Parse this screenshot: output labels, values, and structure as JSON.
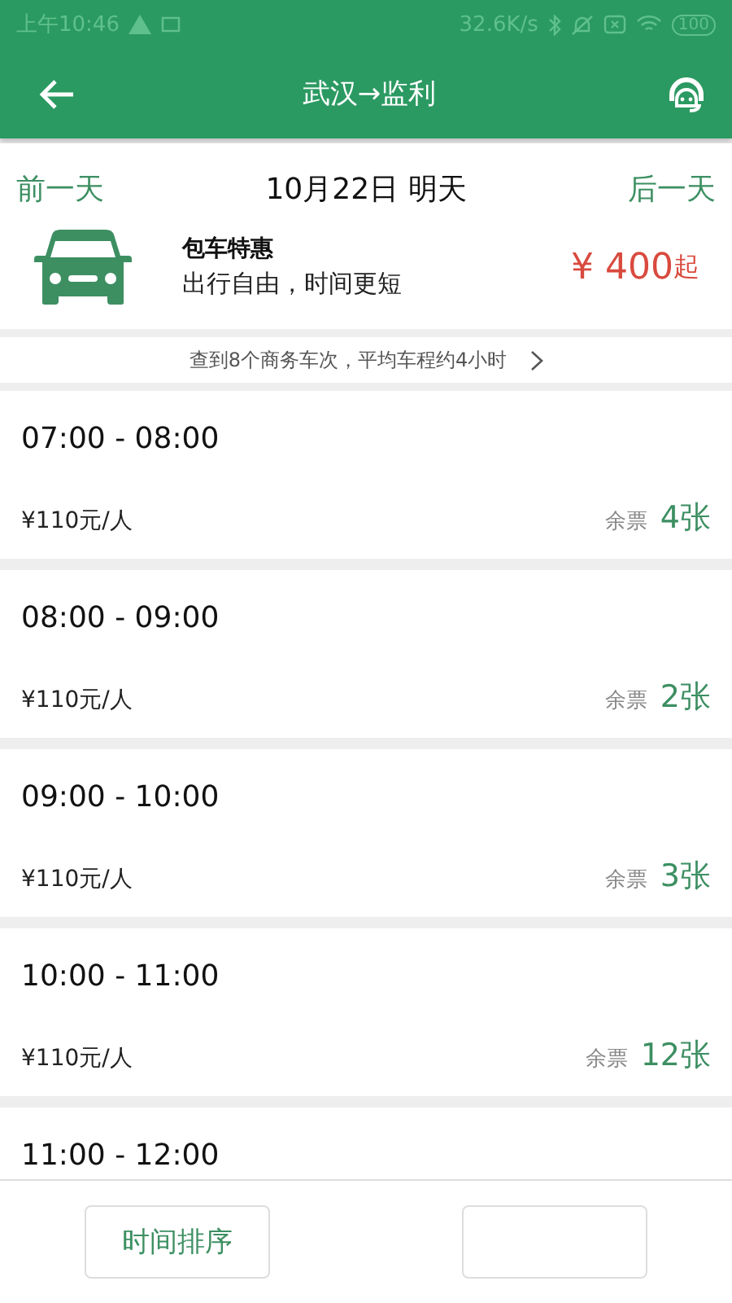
{
  "status_bar": {
    "time": "上午10:46",
    "speed": "32.6K/s",
    "battery": "100"
  },
  "header": {
    "title": "武汉→监利"
  },
  "date_bar": {
    "prev": "前一天",
    "date": "10月22日 明天",
    "next": "后一天"
  },
  "charter": {
    "title": "包车特惠",
    "subtitle": "出行自由，时间更短",
    "price": "¥ 400",
    "suffix": "起"
  },
  "summary": "查到8个商务车次，平均车程约4小时",
  "trips": [
    {
      "time": "07:00 - 08:00",
      "price": "¥110元/人",
      "remain_label": "余票",
      "remain": "4张"
    },
    {
      "time": "08:00 - 09:00",
      "price": "¥110元/人",
      "remain_label": "余票",
      "remain": "2张"
    },
    {
      "time": "09:00 - 10:00",
      "price": "¥110元/人",
      "remain_label": "余票",
      "remain": "3张"
    },
    {
      "time": "10:00 - 11:00",
      "price": "¥110元/人",
      "remain_label": "余票",
      "remain": "12张"
    },
    {
      "time": "11:00 - 12:00"
    }
  ],
  "bottom_buttons": [
    {
      "kind": "labeled",
      "label": "时间排序"
    },
    {
      "kind": "blank"
    }
  ]
}
